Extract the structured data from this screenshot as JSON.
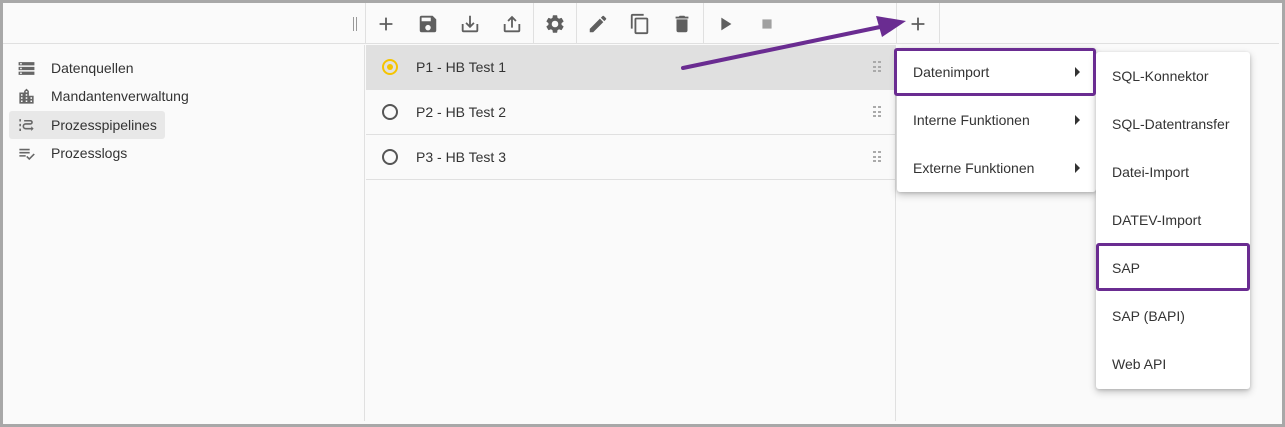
{
  "toolbar": {
    "icons": [
      "add-icon",
      "save-icon",
      "download-icon",
      "upload-icon",
      "settings-icon",
      "edit-icon",
      "copy-icon",
      "delete-icon",
      "play-icon",
      "stop-icon",
      "add-step-icon"
    ]
  },
  "sidebar": {
    "items": [
      {
        "label": "Datenquellen",
        "icon": "storage-icon"
      },
      {
        "label": "Mandantenverwaltung",
        "icon": "building-icon"
      },
      {
        "label": "Prozesspipelines",
        "icon": "pipeline-icon",
        "active": true
      },
      {
        "label": "Prozesslogs",
        "icon": "checklist-icon"
      }
    ]
  },
  "pipelines": [
    {
      "label": "P1 - HB Test 1",
      "selected": true
    },
    {
      "label": "P2 - HB Test 2",
      "selected": false
    },
    {
      "label": "P3 - HB Test 3",
      "selected": false
    }
  ],
  "menu": {
    "items": [
      "Datenimport",
      "Interne Funktionen",
      "Externe Funktionen"
    ]
  },
  "submenu": {
    "items": [
      "SQL-Konnektor",
      "SQL-Datentransfer",
      "Datei-Import",
      "DATEV-Import",
      "SAP",
      "SAP (BAPI)",
      "Web API"
    ]
  },
  "colors": {
    "highlight": "#6a2c91",
    "radio_selected": "#f5c400",
    "selected_row": "#e0e0e0"
  }
}
